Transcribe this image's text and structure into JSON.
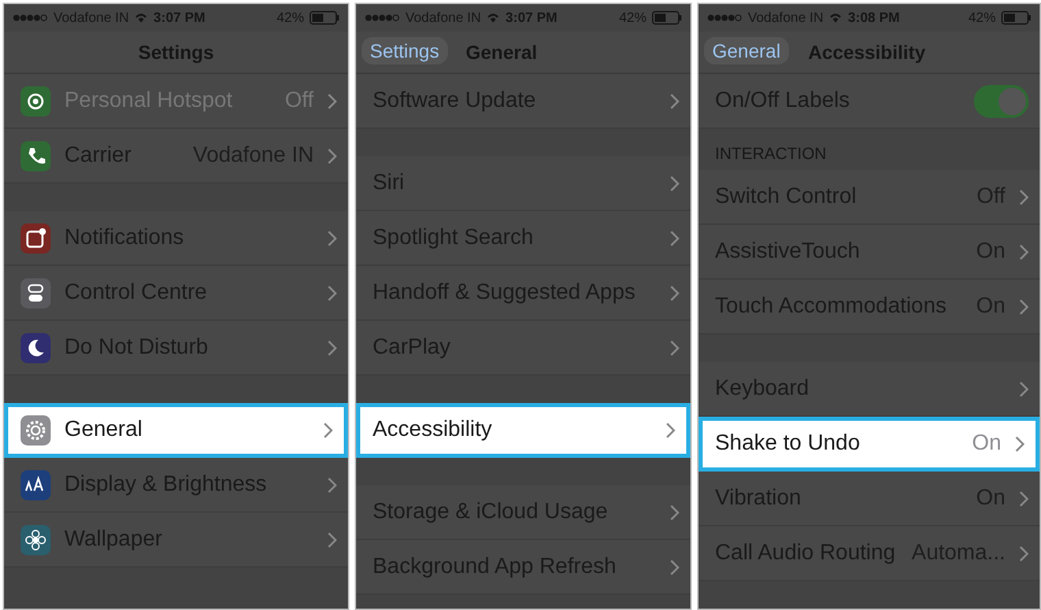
{
  "screens": [
    {
      "status_bar": {
        "carrier": "Vodafone IN",
        "time": "3:07 PM",
        "battery": "42%"
      },
      "nav": {
        "title": "Settings"
      },
      "items": [
        {
          "kind": "row",
          "label": "Personal Hotspot",
          "value": "Off",
          "color": "#2f6b35",
          "disabled": true,
          "selected": false
        },
        {
          "kind": "row",
          "label": "Carrier",
          "value": "Vodafone IN",
          "color": "#2f6b35",
          "disabled": false,
          "selected": false
        },
        {
          "kind": "gap"
        },
        {
          "kind": "row",
          "label": "Notifications",
          "color": "#7a2622",
          "disabled": false,
          "selected": false
        },
        {
          "kind": "row",
          "label": "Control Centre",
          "color": "#5a5a5e",
          "disabled": false,
          "selected": false
        },
        {
          "kind": "row",
          "label": "Do Not Disturb",
          "color": "#302e70",
          "disabled": false,
          "selected": false
        },
        {
          "kind": "gap"
        },
        {
          "kind": "row",
          "label": "General",
          "color": "#8e8e93",
          "disabled": false,
          "selected": true
        },
        {
          "kind": "row",
          "label": "Display & Brightness",
          "color": "#1d3f7c",
          "disabled": false,
          "selected": false
        },
        {
          "kind": "row",
          "label": "Wallpaper",
          "color": "#2a5f6e",
          "disabled": false,
          "selected": false
        }
      ]
    },
    {
      "status_bar": {
        "carrier": "Vodafone IN",
        "time": "3:07 PM",
        "battery": "42%"
      },
      "nav": {
        "back": "Settings",
        "title": "General"
      },
      "items": [
        {
          "kind": "row",
          "label": "Software Update",
          "selected": false
        },
        {
          "kind": "gap"
        },
        {
          "kind": "row",
          "label": "Siri",
          "selected": false
        },
        {
          "kind": "row",
          "label": "Spotlight Search",
          "selected": false
        },
        {
          "kind": "row",
          "label": "Handoff & Suggested Apps",
          "selected": false
        },
        {
          "kind": "row",
          "label": "CarPlay",
          "selected": false
        },
        {
          "kind": "gap"
        },
        {
          "kind": "row",
          "label": "Accessibility",
          "selected": true
        },
        {
          "kind": "gap"
        },
        {
          "kind": "row",
          "label": "Storage & iCloud Usage",
          "selected": false
        },
        {
          "kind": "row",
          "label": "Background App Refresh",
          "selected": false
        }
      ]
    },
    {
      "status_bar": {
        "carrier": "Vodafone IN",
        "time": "3:08 PM",
        "battery": "42%"
      },
      "nav": {
        "back": "General",
        "title": "Accessibility"
      },
      "items": [
        {
          "kind": "toggle",
          "label": "On/Off Labels",
          "on": true,
          "selected": false
        },
        {
          "kind": "header",
          "label": "INTERACTION"
        },
        {
          "kind": "row",
          "label": "Switch Control",
          "value": "Off",
          "selected": false
        },
        {
          "kind": "row",
          "label": "AssistiveTouch",
          "value": "On",
          "selected": false
        },
        {
          "kind": "row",
          "label": "Touch Accommodations",
          "value": "On",
          "selected": false
        },
        {
          "kind": "gap"
        },
        {
          "kind": "row",
          "label": "Keyboard",
          "selected": false
        },
        {
          "kind": "row",
          "label": "Shake to Undo",
          "value": "On",
          "selected": true
        },
        {
          "kind": "row",
          "label": "Vibration",
          "value": "On",
          "selected": false
        },
        {
          "kind": "row",
          "label": "Call Audio Routing",
          "value": "Automa...",
          "selected": false
        }
      ]
    }
  ]
}
